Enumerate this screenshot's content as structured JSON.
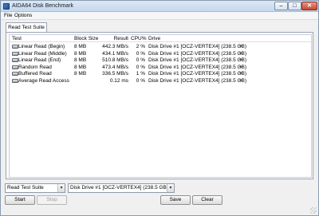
{
  "window": {
    "title": "AIDA64 Disk Benchmark",
    "controls": {
      "minimize": "–",
      "maximize": "□",
      "close": "✕"
    }
  },
  "menu": {
    "file": "File",
    "options": "Options"
  },
  "tab": "Read Test Suite",
  "table": {
    "headers": {
      "test": "Test",
      "block_size": "Block Size",
      "result": "Result",
      "cpu": "CPU%",
      "drive": "Drive"
    },
    "rows": [
      {
        "test": "Linear Read (Begin)",
        "block_size": "8 MB",
        "result": "442.3 MB/s",
        "cpu": "2 %",
        "drive": "Disk Drive #1  [OCZ-VERTEX4]  (238.5 GB)"
      },
      {
        "test": "Linear Read (Middle)",
        "block_size": "8 MB",
        "result": "434.1 MB/s",
        "cpu": "0 %",
        "drive": "Disk Drive #1  [OCZ-VERTEX4]  (238.5 GB)"
      },
      {
        "test": "Linear Read (End)",
        "block_size": "8 MB",
        "result": "510.8 MB/s",
        "cpu": "0 %",
        "drive": "Disk Drive #1  [OCZ-VERTEX4]  (238.5 GB)"
      },
      {
        "test": "Random Read",
        "block_size": "8 MB",
        "result": "473.4 MB/s",
        "cpu": "0 %",
        "drive": "Disk Drive #1  [OCZ-VERTEX4]  (238.5 GB)"
      },
      {
        "test": "Buffered Read",
        "block_size": "8 MB",
        "result": "336.5 MB/s",
        "cpu": "1 %",
        "drive": "Disk Drive #1  [OCZ-VERTEX4]  (238.5 GB)"
      },
      {
        "test": "Average Read Access",
        "block_size": "",
        "result": "0.12 ms",
        "cpu": "0 %",
        "drive": "Disk Drive #1  [OCZ-VERTEX4]  (238.5 GB)"
      }
    ]
  },
  "bottom": {
    "suite_select": "Read Test Suite",
    "drive_select": "Disk Drive #1  [OCZ-VERTEX4]  (238.5 GB)",
    "start": "Start",
    "stop": "Stop",
    "save": "Save",
    "clear": "Clear"
  },
  "icons": {
    "app": "aida64-app-icon",
    "row": "hard-disk-icon",
    "row_arrow": "dropdown-arrow-icon"
  }
}
